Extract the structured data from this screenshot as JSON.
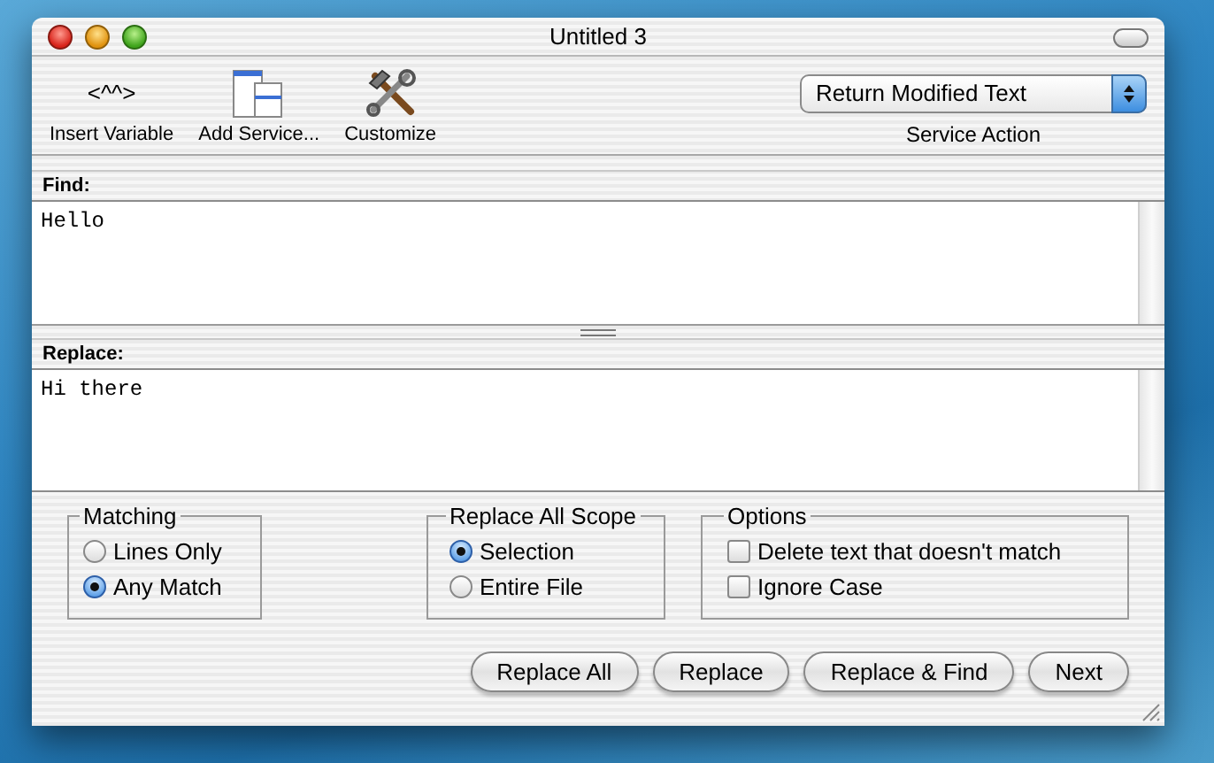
{
  "window": {
    "title": "Untitled 3"
  },
  "toolbar": {
    "items": [
      {
        "kind": "glyph",
        "glyph": "<^^>",
        "label": "Insert Variable"
      },
      {
        "kind": "windows",
        "label": "Add Service..."
      },
      {
        "kind": "tools",
        "label": "Customize"
      }
    ],
    "service_action": {
      "value": "Return Modified Text",
      "label": "Service Action"
    }
  },
  "find": {
    "label": "Find:",
    "value": "Hello"
  },
  "replace": {
    "label": "Replace:",
    "value": "Hi there"
  },
  "matching": {
    "title": "Matching",
    "options": [
      {
        "label": "Lines Only",
        "selected": false
      },
      {
        "label": "Any Match",
        "selected": true
      }
    ]
  },
  "scope": {
    "title": "Replace All Scope",
    "options": [
      {
        "label": "Selection",
        "selected": true
      },
      {
        "label": "Entire File",
        "selected": false
      }
    ]
  },
  "options": {
    "title": "Options",
    "options": [
      {
        "label": "Delete text that doesn't match",
        "checked": false
      },
      {
        "label": "Ignore Case",
        "checked": false
      }
    ]
  },
  "buttons": [
    "Replace All",
    "Replace",
    "Replace & Find",
    "Next"
  ]
}
